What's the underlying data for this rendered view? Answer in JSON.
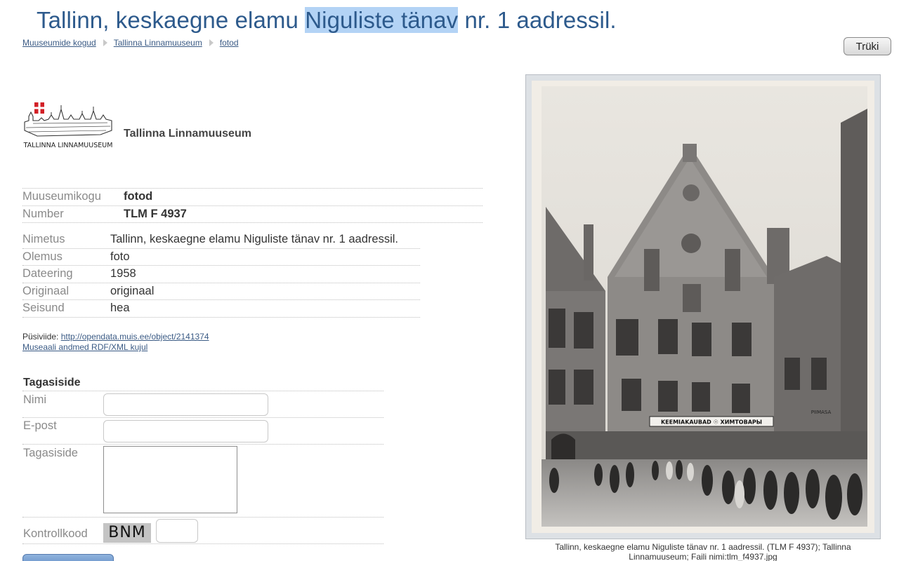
{
  "title": {
    "before": "Tallinn, keskaegne elamu ",
    "highlight": "Niguliste tänav",
    "after": " nr. 1 aadressil."
  },
  "breadcrumb": [
    "Muuseumide kogud",
    "Tallinna Linnamuuseum",
    "fotod"
  ],
  "print_label": "Trüki",
  "museum": {
    "logo_text": "TALLINNA LINNAMUUSEUM",
    "name": "Tallinna Linnamuuseum"
  },
  "collection": [
    {
      "label": "Muuseumikogu",
      "value": "fotod"
    },
    {
      "label": "Number",
      "value": "TLM F 4937"
    }
  ],
  "details": [
    {
      "label": "Nimetus",
      "value": "Tallinn, keskaegne elamu Niguliste tänav nr. 1 aadressil."
    },
    {
      "label": "Olemus",
      "value": "foto"
    },
    {
      "label": "Dateering",
      "value": "1958"
    },
    {
      "label": "Originaal",
      "value": "originaal"
    },
    {
      "label": "Seisund",
      "value": "hea"
    }
  ],
  "permalink": {
    "label": "Püsiviide: ",
    "url": "http://opendata.muis.ee/object/2141374",
    "rdf_link": "Museaali andmed RDF/XML kujul"
  },
  "feedback": {
    "title": "Tagasiside",
    "name_label": "Nimi",
    "email_label": "E-post",
    "message_label": "Tagasiside",
    "captcha_label": "Kontrollkood",
    "captcha_code": "BNM"
  },
  "photo": {
    "sign_text": "KEEMIAKAUBAD ☉ ХИМТОВАРЫ",
    "small_sign": "PIIMASA"
  },
  "caption": {
    "line1": "Tallinn, keskaegne elamu Niguliste tänav nr. 1 aadressil. (TLM F 4937); Tallinna",
    "line2": "Linnamuuseum; Faili nimi:tlm_f4937.jpg"
  }
}
